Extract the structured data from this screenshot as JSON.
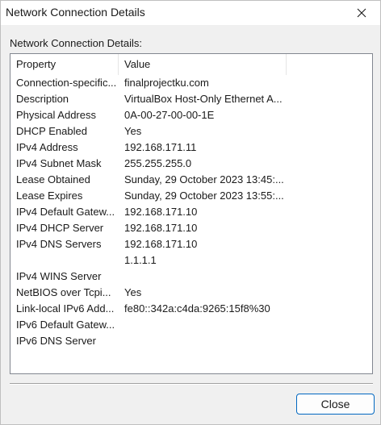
{
  "window": {
    "title": "Network Connection Details",
    "close_icon": "close-icon"
  },
  "group_label": "Network Connection Details:",
  "columns": [
    "Property",
    "Value"
  ],
  "rows": [
    {
      "property": "Connection-specific...",
      "value": "finalprojectku.com"
    },
    {
      "property": "Description",
      "value": "VirtualBox Host-Only Ethernet A..."
    },
    {
      "property": "Physical Address",
      "value": "0A-00-27-00-00-1E"
    },
    {
      "property": "DHCP Enabled",
      "value": "Yes"
    },
    {
      "property": "IPv4 Address",
      "value": "192.168.171.11"
    },
    {
      "property": "IPv4 Subnet Mask",
      "value": "255.255.255.0"
    },
    {
      "property": "Lease Obtained",
      "value": "Sunday, 29 October 2023 13:45:..."
    },
    {
      "property": "Lease Expires",
      "value": "Sunday, 29 October 2023 13:55:..."
    },
    {
      "property": "IPv4 Default Gatew...",
      "value": "192.168.171.10"
    },
    {
      "property": "IPv4 DHCP Server",
      "value": "192.168.171.10"
    },
    {
      "property": "IPv4 DNS Servers",
      "value": "192.168.171.10"
    },
    {
      "property": "",
      "value": "1.1.1.1"
    },
    {
      "property": "IPv4 WINS Server",
      "value": ""
    },
    {
      "property": "NetBIOS over Tcpi...",
      "value": "Yes"
    },
    {
      "property": "Link-local IPv6 Add...",
      "value": "fe80::342a:c4da:9265:15f8%30"
    },
    {
      "property": "IPv6 Default Gatew...",
      "value": ""
    },
    {
      "property": "IPv6 DNS Server",
      "value": ""
    }
  ],
  "buttons": {
    "close_label": "Close"
  }
}
